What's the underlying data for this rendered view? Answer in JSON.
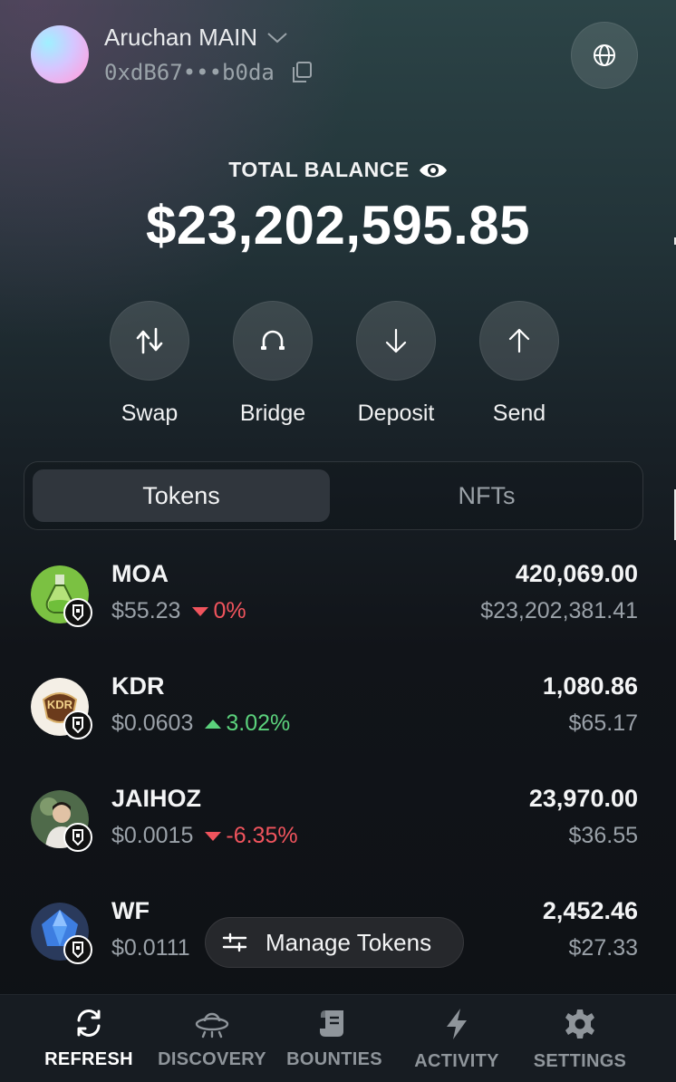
{
  "account": {
    "name": "Aruchan MAIN",
    "address": "0xdB67•••b0da"
  },
  "balance": {
    "label": "TOTAL BALANCE",
    "value": "$23,202,595.85"
  },
  "actions": [
    {
      "label": "Swap",
      "icon": "swap-icon"
    },
    {
      "label": "Bridge",
      "icon": "bridge-icon"
    },
    {
      "label": "Deposit",
      "icon": "arrow-down-icon"
    },
    {
      "label": "Send",
      "icon": "arrow-up-icon"
    }
  ],
  "tabs": [
    {
      "label": "Tokens",
      "active": true
    },
    {
      "label": "NFTs",
      "active": false
    }
  ],
  "tokens": [
    {
      "symbol": "MOA",
      "price": "$55.23",
      "change": "0%",
      "direction": "down",
      "amount": "420,069.00",
      "usd": "$23,202,381.41"
    },
    {
      "symbol": "KDR",
      "logo_text": "KDR",
      "price": "$0.0603",
      "change": "3.02%",
      "direction": "up",
      "amount": "1,080.86",
      "usd": "$65.17"
    },
    {
      "symbol": "JAIHOZ",
      "price": "$0.0015",
      "change": "-6.35%",
      "direction": "down",
      "amount": "23,970.00",
      "usd": "$36.55"
    },
    {
      "symbol": "WF",
      "price": "$0.0111",
      "amount": "2,452.46",
      "usd": "$27.33"
    }
  ],
  "manage_tokens": {
    "label": "Manage Tokens"
  },
  "nav": [
    {
      "label": "REFRESH",
      "icon": "refresh-icon",
      "active": true
    },
    {
      "label": "DISCOVERY",
      "icon": "ufo-icon",
      "active": false
    },
    {
      "label": "BOUNTIES",
      "icon": "scroll-icon",
      "active": false
    },
    {
      "label": "ACTIVITY",
      "icon": "lightning-icon",
      "active": false
    },
    {
      "label": "SETTINGS",
      "icon": "gear-icon",
      "active": false
    }
  ],
  "colors": {
    "positive": "#5bd27c",
    "negative": "#f0545d",
    "muted": "#9aa1a8"
  }
}
